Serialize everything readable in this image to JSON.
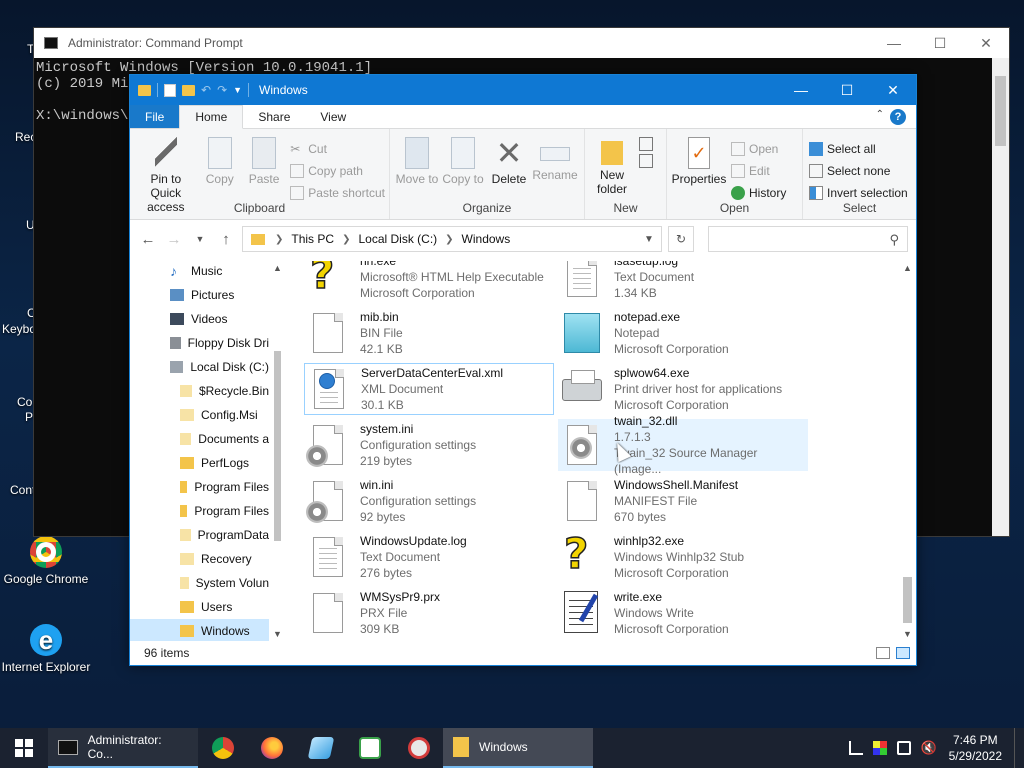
{
  "desktop": {
    "icons": [
      {
        "label": "Google Chrome"
      },
      {
        "label": "Internet Explorer"
      }
    ],
    "clipped_labels": [
      "T",
      "Rec",
      "U",
      "C",
      "Keybo",
      "Co",
      "P",
      "Cont"
    ]
  },
  "cmd": {
    "title": "Administrator: Command Prompt",
    "lines": [
      "Microsoft Windows [Version 10.0.19041.1]",
      "(c) 2019 Mic",
      "",
      "X:\\windows\\S"
    ]
  },
  "explorer": {
    "title": "Windows",
    "tabs": {
      "file": "File",
      "home": "Home",
      "share": "Share",
      "view": "View"
    },
    "help": "?",
    "ribbon": {
      "clipboard": {
        "group": "Clipboard",
        "pin": "Pin to Quick access",
        "copy": "Copy",
        "paste": "Paste",
        "cut": "Cut",
        "copy_path": "Copy path",
        "paste_shortcut": "Paste shortcut"
      },
      "organize": {
        "group": "Organize",
        "move_to": "Move to",
        "copy_to": "Copy to",
        "delete": "Delete",
        "rename": "Rename"
      },
      "new": {
        "group": "New",
        "new_folder": "New folder"
      },
      "open": {
        "group": "Open",
        "properties": "Properties",
        "open": "Open",
        "edit": "Edit",
        "history": "History"
      },
      "select": {
        "group": "Select",
        "select_all": "Select all",
        "select_none": "Select none",
        "invert_selection": "Invert selection"
      }
    },
    "address": {
      "crumbs": [
        "This PC",
        "Local Disk (C:)",
        "Windows"
      ]
    },
    "search": {
      "placeholder": ""
    },
    "nav_items": [
      {
        "label": "Music",
        "indent": 1
      },
      {
        "label": "Pictures",
        "indent": 1
      },
      {
        "label": "Videos",
        "indent": 1
      },
      {
        "label": "Floppy Disk Dri",
        "indent": 1
      },
      {
        "label": "Local Disk (C:)",
        "indent": 1
      },
      {
        "label": "$Recycle.Bin",
        "indent": 2
      },
      {
        "label": "Config.Msi",
        "indent": 2
      },
      {
        "label": "Documents a",
        "indent": 2
      },
      {
        "label": "PerfLogs",
        "indent": 2
      },
      {
        "label": "Program Files",
        "indent": 2
      },
      {
        "label": "Program Files",
        "indent": 2
      },
      {
        "label": "ProgramData",
        "indent": 2
      },
      {
        "label": "Recovery",
        "indent": 2
      },
      {
        "label": "System Volun",
        "indent": 2
      },
      {
        "label": "Users",
        "indent": 2
      },
      {
        "label": "Windows",
        "indent": 2
      }
    ],
    "files": [
      {
        "name": "hh.exe",
        "type": "Microsoft® HTML Help Executable",
        "detail": "Microsoft Corporation",
        "icon": "help-exe-icon"
      },
      {
        "name": "isasetup.log",
        "type": "Text Document",
        "detail": "1.34 KB",
        "icon": "text-file-icon"
      },
      {
        "name": "mib.bin",
        "type": "BIN File",
        "detail": "42.1 KB",
        "icon": "blank-file-icon"
      },
      {
        "name": "notepad.exe",
        "type": "Notepad",
        "detail": "Microsoft Corporation",
        "icon": "notepad-icon"
      },
      {
        "name": "ServerDataCenterEval.xml",
        "type": "XML Document",
        "detail": "30.1 KB",
        "icon": "xml-file-icon"
      },
      {
        "name": "splwow64.exe",
        "type": "Print driver host for applications",
        "detail": "Microsoft Corporation",
        "icon": "printer-icon"
      },
      {
        "name": "system.ini",
        "type": "Configuration settings",
        "detail": "219 bytes",
        "icon": "config-file-icon"
      },
      {
        "name": "twain_32.dll",
        "type": "1.7.1.3",
        "detail": "Twain_32 Source Manager (Image...",
        "icon": "dll-file-icon"
      },
      {
        "name": "win.ini",
        "type": "Configuration settings",
        "detail": "92 bytes",
        "icon": "config-file-icon"
      },
      {
        "name": "WindowsShell.Manifest",
        "type": "MANIFEST File",
        "detail": "670 bytes",
        "icon": "blank-file-icon"
      },
      {
        "name": "WindowsUpdate.log",
        "type": "Text Document",
        "detail": "276 bytes",
        "icon": "text-file-icon"
      },
      {
        "name": "winhlp32.exe",
        "type": "Windows Winhlp32 Stub",
        "detail": "Microsoft Corporation",
        "icon": "help-exe-icon"
      },
      {
        "name": "WMSysPr9.prx",
        "type": "PRX File",
        "detail": "309 KB",
        "icon": "blank-file-icon"
      },
      {
        "name": "write.exe",
        "type": "Windows Write",
        "detail": "Microsoft Corporation",
        "icon": "write-icon"
      }
    ],
    "status": {
      "count": "96 items"
    }
  },
  "taskbar": {
    "tasks": [
      {
        "label": "Administrator: Co..."
      },
      {
        "label": "Windows"
      }
    ],
    "clock": {
      "time": "7:46 PM",
      "date": "5/29/2022"
    }
  },
  "colors": {
    "accent": "#0f78d3",
    "selection": "#cce8ff",
    "hover": "#e5f3ff"
  }
}
